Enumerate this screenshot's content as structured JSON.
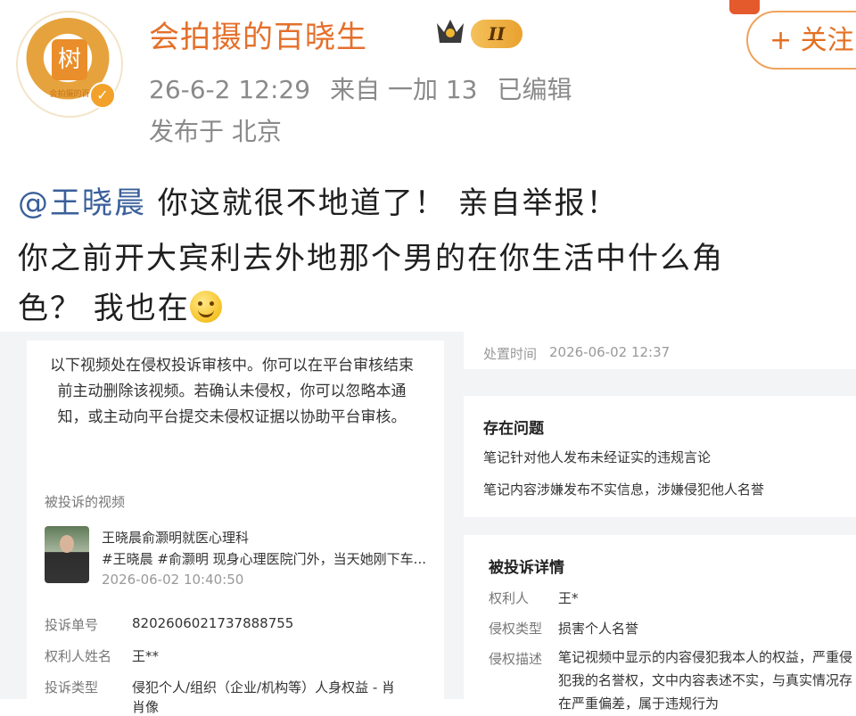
{
  "post": {
    "username": "会拍摄的百晓生",
    "avatar_text": "树",
    "avatar_caption": "会拍摄的百",
    "level_badge": "II",
    "follow_label": "+ 关注",
    "date": "26-6-2 12:29",
    "source": "来自 一加 13",
    "edited": "已编辑",
    "location": "发布于 北京",
    "mention": "@王晓晨",
    "line1_rest": " 你这就很不地道了！ 亲自举报！",
    "line2": "你之前开大宾利去外地那个男的在你生活中什么角",
    "line3": "色？ 我也在",
    "accent_color": "#e4702b"
  },
  "complaint_left": {
    "notice": "以下视频处在侵权投诉审核中。你可以在平台审核结束前主动删除该视频。若确认未侵权，你可以忽略本通知，或主动向平台提交未侵权证据以协助平台审核。",
    "video_section_label": "被投诉的视频",
    "video_title": "王晓晨俞灏明就医心理科",
    "video_tags": "#王晓晨 #俞灏明 现身心理医院门外，当天她刚下车...",
    "video_time": "2026-06-02 10:40:50",
    "complaint_no_label": "投诉单号",
    "complaint_no": "8202606021737888755",
    "rights_holder_label": "权利人姓名",
    "rights_holder": "王**",
    "complaint_type_label": "投诉类型",
    "complaint_type": "侵犯个人/组织（企业/机构等）人身权益 - 肖",
    "complaint_type_cont": "肖像"
  },
  "complaint_right": {
    "handle_time_label": "处置时间",
    "handle_time": "2026-06-02 12:37",
    "issue_title": "存在问题",
    "issue_1": "笔记针对他人发布未经证实的违规言论",
    "issue_2": "笔记内容涉嫌发布不实信息，涉嫌侵犯他人名誉",
    "detail_title": "被投诉详情",
    "holder_label": "权利人",
    "holder": "王*",
    "type_label": "侵权类型",
    "type": "损害个人名誉",
    "desc_label": "侵权描述",
    "desc": "笔记视频中显示的内容侵犯我本人的权益，严重侵犯我的名誉权，文中内容表述不实，与真实情况存在严重偏差，属于违规行为"
  }
}
